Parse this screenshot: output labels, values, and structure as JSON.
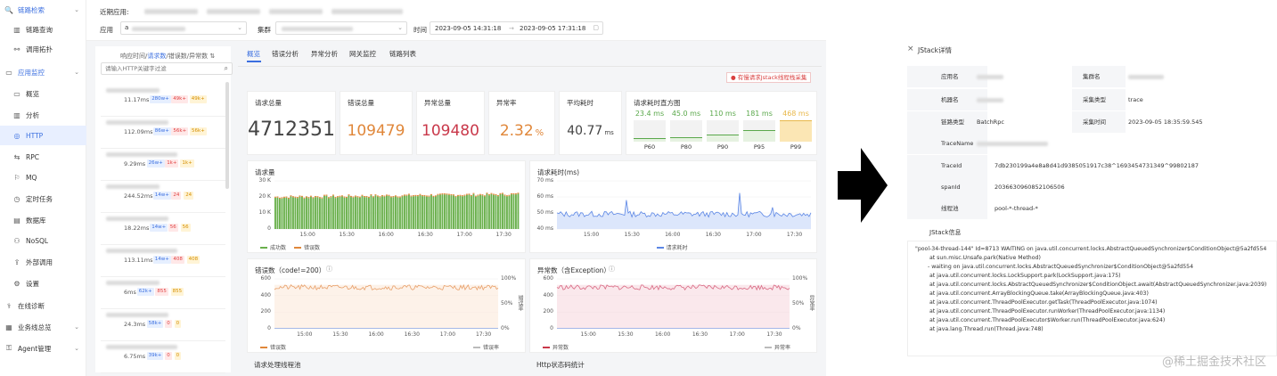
{
  "sidebar": {
    "items": [
      {
        "icon": "🔍",
        "label": "链路检索",
        "type": "group",
        "chev": "⌄"
      },
      {
        "icon": "▥",
        "label": "链路查询",
        "type": "sub"
      },
      {
        "icon": "⚯",
        "label": "调用拓扑",
        "type": "sub"
      },
      {
        "icon": "▭",
        "label": "应用监控",
        "type": "group",
        "chev": "⌄"
      },
      {
        "icon": "▭",
        "label": "概览",
        "type": "sub"
      },
      {
        "icon": "▥",
        "label": "分析",
        "type": "sub"
      },
      {
        "icon": "◎",
        "label": "HTTP",
        "type": "sub",
        "active": true
      },
      {
        "icon": "⇆",
        "label": "RPC",
        "type": "sub"
      },
      {
        "icon": "⚐",
        "label": "MQ",
        "type": "sub"
      },
      {
        "icon": "◷",
        "label": "定时任务",
        "type": "sub"
      },
      {
        "icon": "▤",
        "label": "数据库",
        "type": "sub"
      },
      {
        "icon": "⚇",
        "label": "NoSQL",
        "type": "sub"
      },
      {
        "icon": "⇪",
        "label": "外部调用",
        "type": "sub"
      },
      {
        "icon": "⚙",
        "label": "设置",
        "type": "sub"
      },
      {
        "icon": "⚕",
        "label": "在线诊断",
        "type": "top"
      },
      {
        "icon": "▦",
        "label": "业务线总览",
        "type": "top",
        "chev": "⌄"
      },
      {
        "icon": "⚿",
        "label": "Agent管理",
        "type": "top",
        "chev": "⌄"
      }
    ]
  },
  "topbar": {
    "recent_label": "近期应用:",
    "app_label": "应用",
    "app_value": "a",
    "cluster_label": "集群",
    "time_label": "时间",
    "time_start": "2023-09-05 14:31:18",
    "time_sep": "→",
    "time_end": "2023-09-05 17:31:18"
  },
  "leftpanel": {
    "tabs": [
      "响应时间",
      "请求数",
      "错误数",
      "异常数"
    ],
    "tab_seps": [
      "/",
      "/",
      "/"
    ],
    "sort_icon": "⇅",
    "search_placeholder": "请输入HTTP关键字过滤",
    "rows": [
      {
        "ms": "11.17ms",
        "b1": "280w+",
        "b2": "49k+",
        "b3": "49k+"
      },
      {
        "ms": "112.09ms",
        "b1": "86w+",
        "b2": "56k+",
        "b3": "56k+"
      },
      {
        "ms": "9.29ms",
        "b1": "26w+",
        "b2": "1k+",
        "b3": "1k+"
      },
      {
        "ms": "244.52ms",
        "b1": "14w+",
        "b2": "24",
        "b3": "24"
      },
      {
        "ms": "18.22ms",
        "b1": "14w+",
        "b2": "56",
        "b3": "56"
      },
      {
        "ms": "113.11ms",
        "b1": "14w+",
        "b2": "408",
        "b3": "408"
      },
      {
        "ms": "6ms",
        "b1": "62k+",
        "b2": "855",
        "b3": "855"
      },
      {
        "ms": "24.3ms",
        "b1": "58k+",
        "b2": "0",
        "b3": "0"
      },
      {
        "ms": "6.75ms",
        "b1": "39k+",
        "b2": "0",
        "b3": "0"
      }
    ]
  },
  "main": {
    "tabs": [
      "概览",
      "错误分析",
      "异常分析",
      "网关监控",
      "链路列表"
    ],
    "alert": "有慢请求Jstack线程栈采集",
    "stats": [
      {
        "title": "请求总量",
        "value": "4712351",
        "color": "#444"
      },
      {
        "title": "错误总量",
        "value": "109479",
        "color": "#e0873a"
      },
      {
        "title": "异常总量",
        "value": "109480",
        "color": "#c9384a"
      },
      {
        "title": "异常率",
        "value": "2.32",
        "unit": "%",
        "color": "#e0873a"
      },
      {
        "title": "平均耗时",
        "value": "40.77",
        "unit": "ms",
        "color": "#444"
      }
    ],
    "hist_title": "请求耗时直方图",
    "hist": [
      {
        "label": "P60",
        "value": "23.4 ms",
        "color": "#5aa84b"
      },
      {
        "label": "P80",
        "value": "45.0 ms",
        "color": "#5aa84b"
      },
      {
        "label": "P90",
        "value": "110 ms",
        "color": "#5aa84b"
      },
      {
        "label": "P95",
        "value": "181 ms",
        "color": "#5aa84b"
      },
      {
        "label": "P99",
        "value": "468 ms",
        "color": "#e8b84a"
      }
    ],
    "ticks": [
      "15:00",
      "15:30",
      "16:00",
      "16:30",
      "17:00",
      "17:30"
    ],
    "req_chart": {
      "title": "请求量",
      "yticks": [
        "30 K",
        "20 K",
        "10 K",
        "0"
      ],
      "legend": [
        "成功数",
        "错误数"
      ]
    },
    "lat_chart": {
      "title": "请求耗时(ms)",
      "yticks": [
        "70 ms",
        "60 ms",
        "50 ms",
        "40 ms"
      ],
      "legend": "请求耗时"
    },
    "err_chart": {
      "title": "错误数（code!=200）",
      "yticks": [
        "600",
        "400",
        "200",
        "0"
      ],
      "rticks": [
        "100%",
        "50%",
        "0%"
      ],
      "rlabel": "错误率",
      "legend": [
        "错误数",
        "错误率"
      ]
    },
    "exc_chart": {
      "title": "异常数（含Exception）",
      "yticks": [
        "600",
        "400",
        "200",
        "0"
      ],
      "rticks": [
        "100%",
        "50%",
        "0%"
      ],
      "rlabel": "异常率",
      "legend": [
        "异常数",
        "异常率"
      ]
    },
    "bottom_titles": [
      "请求处理线程池",
      "Http状态码统计"
    ],
    "info_icon": "ⓘ"
  },
  "jstack": {
    "close": "×",
    "title": "JStack详情",
    "fields": [
      {
        "label": "应用名",
        "value": "",
        "label2": "集群名",
        "value2": ""
      },
      {
        "label": "机器名",
        "value": "",
        "label2": "采集类型",
        "value2": "trace"
      },
      {
        "label": "链路类型",
        "value": "BatchRpc",
        "label2": "采集时间",
        "value2": "2023-09-05 18:35:59.545"
      },
      {
        "label": "TraceName",
        "value": ""
      },
      {
        "label": "TraceId",
        "value": "7db230199a4e8a8d41d9385051917c38^1693454731349^99802187"
      },
      {
        "label": "spanId",
        "value": "2036630960852106506"
      },
      {
        "label": "线程池",
        "value": "pool-*-thread-*"
      }
    ],
    "info_title": "JStack信息",
    "lines": [
      "\"pool-34-thread-144\" Id=8713 WAITING on java.util.concurrent.locks.AbstractQueuedSynchronizer$ConditionObject@5a2fd554",
      "at sun.misc.Unsafe.park(Native Method)",
      "-  waiting on java.util.concurrent.locks.AbstractQueuedSynchronizer$ConditionObject@5a2fd554",
      "at java.util.concurrent.locks.LockSupport.park(LockSupport.java:175)",
      "at java.util.concurrent.locks.AbstractQueuedSynchronizer$ConditionObject.await(AbstractQueuedSynchronizer.java:2039)",
      "at java.util.concurrent.ArrayBlockingQueue.take(ArrayBlockingQueue.java:403)",
      "at java.util.concurrent.ThreadPoolExecutor.getTask(ThreadPoolExecutor.java:1074)",
      "at java.util.concurrent.ThreadPoolExecutor.runWorker(ThreadPoolExecutor.java:1134)",
      "at java.util.concurrent.ThreadPoolExecutor$Worker.run(ThreadPoolExecutor.java:624)",
      "at java.lang.Thread.run(Thread.java:748)"
    ]
  },
  "watermark": "@稀土掘金技术社区",
  "colors": {
    "accent": "#3b6fe0",
    "success": "#5aa84b",
    "error": "#e0873a",
    "exception": "#c9384a"
  }
}
